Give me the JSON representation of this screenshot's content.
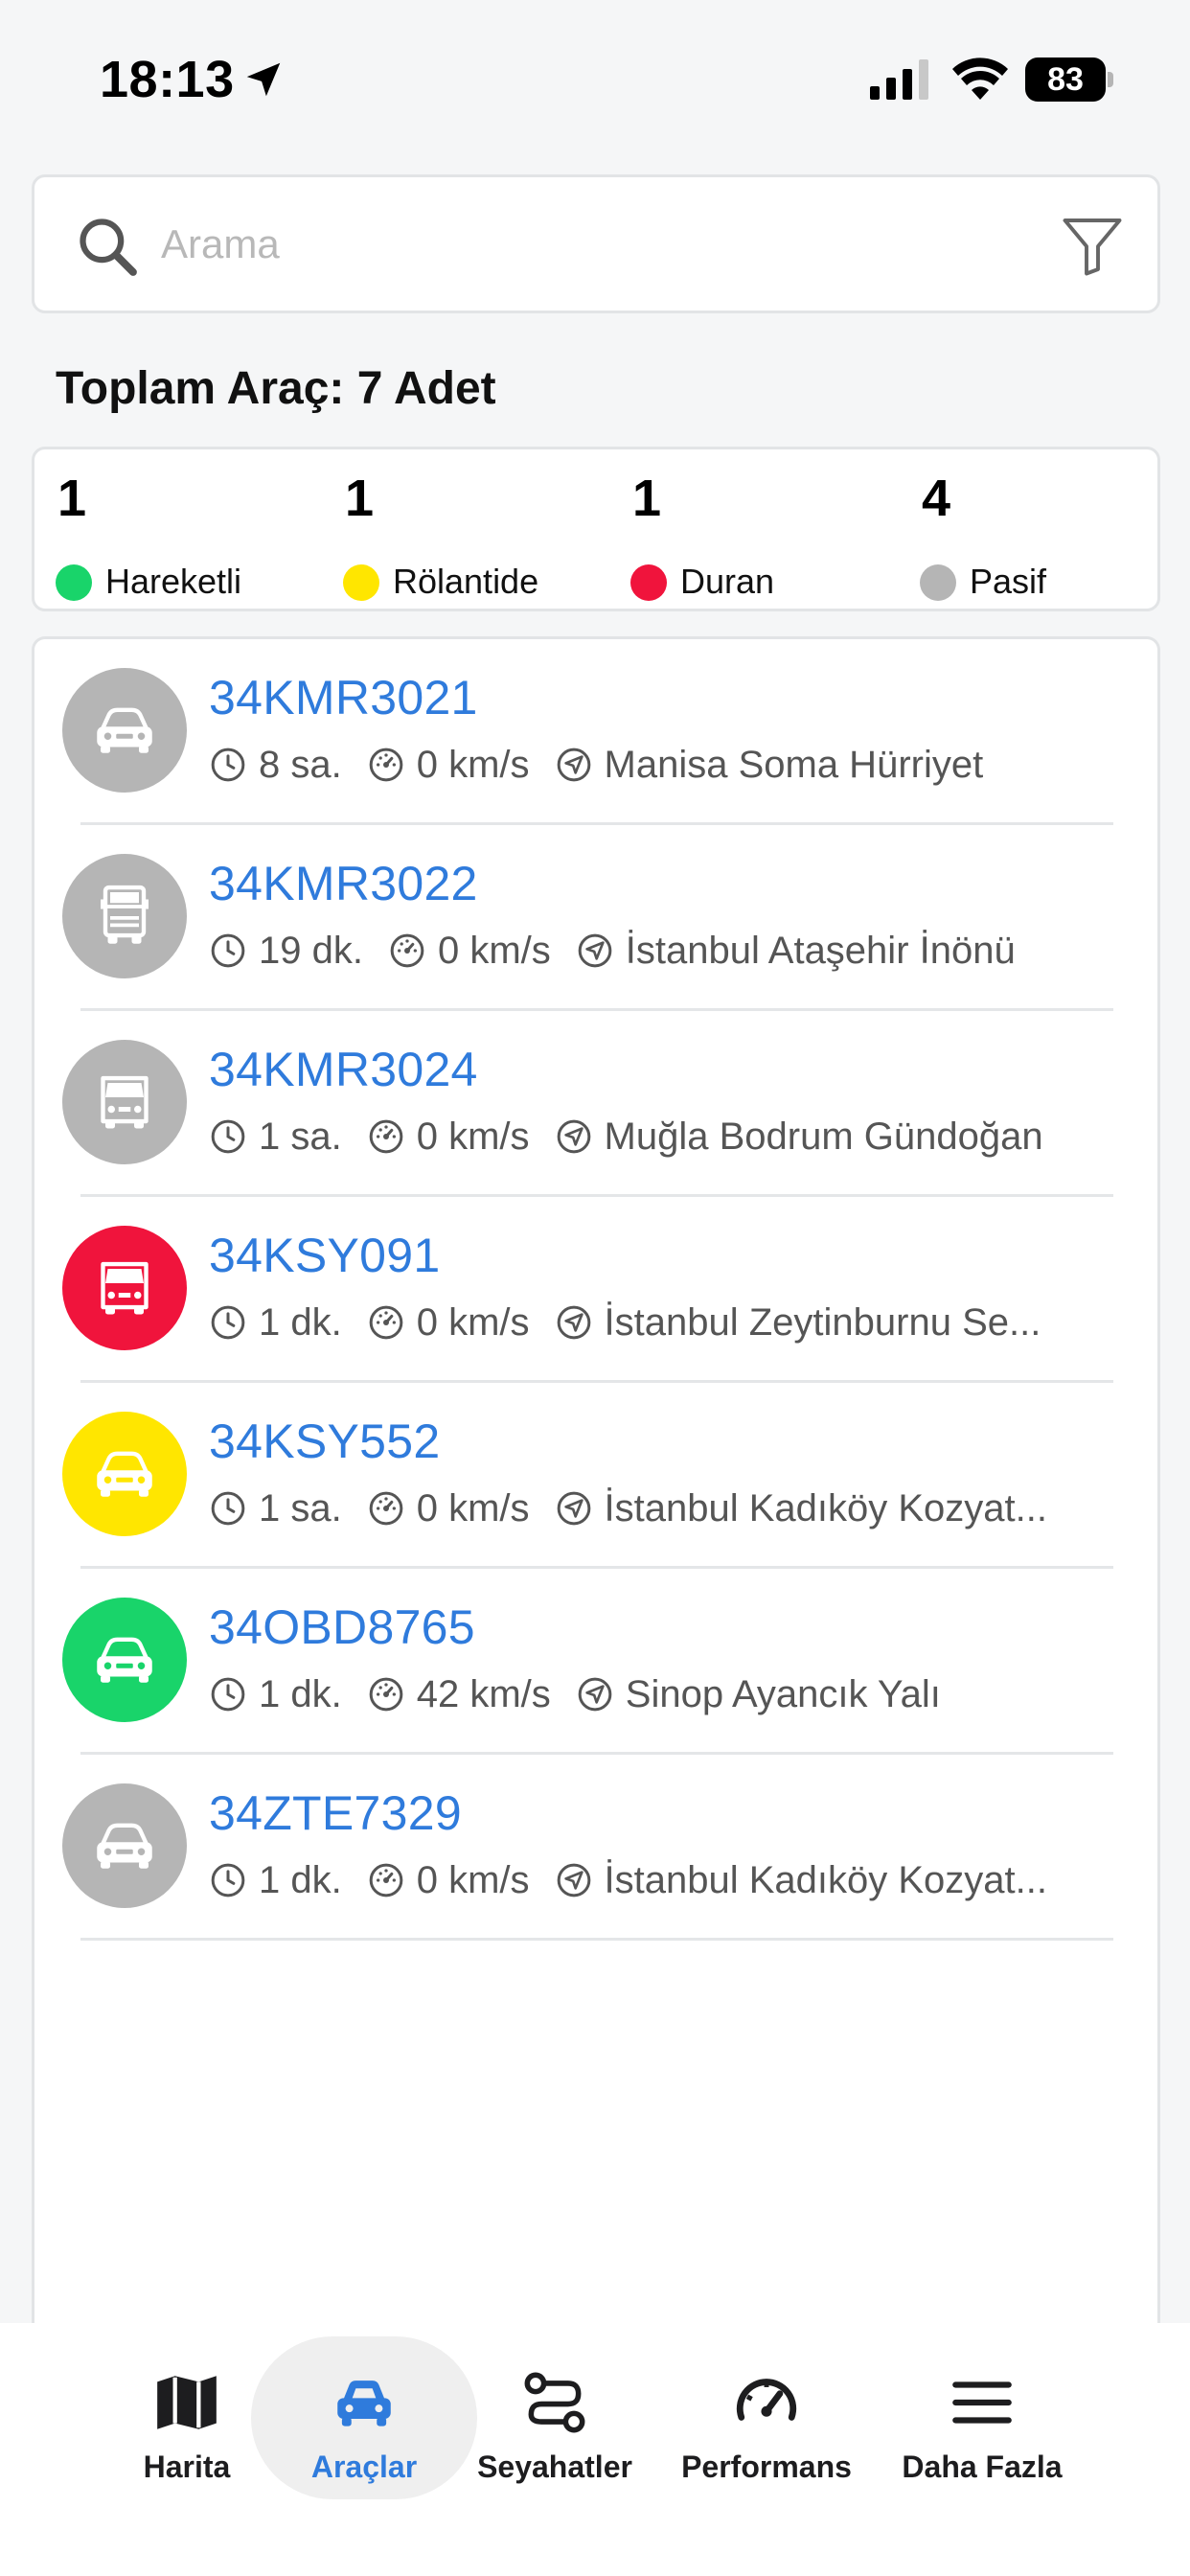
{
  "status_bar": {
    "time": "18:13",
    "battery": "83"
  },
  "search": {
    "placeholder": "Arama"
  },
  "summary": {
    "total_label": "Toplam Araç: 7 Adet"
  },
  "stats": [
    {
      "count": "1",
      "label": "Hareketli",
      "color": "#19d46a"
    },
    {
      "count": "1",
      "label": "Rölantide",
      "color": "#ffe600"
    },
    {
      "count": "1",
      "label": "Duran",
      "color": "#f0143c"
    },
    {
      "count": "4",
      "label": "Pasif",
      "color": "#b5b5b5"
    }
  ],
  "vehicles": [
    {
      "plate": "34KMR3021",
      "time": "8 sa.",
      "speed": "0 km/s",
      "location": "Manisa Soma Hürriyet",
      "status_color": "#b5b5b5",
      "icon": "car-icon"
    },
    {
      "plate": "34KMR3022",
      "time": "19 dk.",
      "speed": "0 km/s",
      "location": "İstanbul Ataşehir İnönü",
      "status_color": "#b5b5b5",
      "icon": "truck-icon"
    },
    {
      "plate": "34KMR3024",
      "time": "1 sa.",
      "speed": "0 km/s",
      "location": "Muğla Bodrum Gündoğan",
      "status_color": "#b5b5b5",
      "icon": "van-icon"
    },
    {
      "plate": "34KSY091",
      "time": "1 dk.",
      "speed": "0 km/s",
      "location": "İstanbul Zeytinburnu Se...",
      "status_color": "#f0143c",
      "icon": "van-icon"
    },
    {
      "plate": "34KSY552",
      "time": "1 sa.",
      "speed": "0 km/s",
      "location": "İstanbul Kadıköy Kozyat...",
      "status_color": "#ffe600",
      "icon": "car-icon"
    },
    {
      "plate": "34OBD8765",
      "time": "1 dk.",
      "speed": "42 km/s",
      "location": "Sinop Ayancık Yalı",
      "status_color": "#19d46a",
      "icon": "car-icon"
    },
    {
      "plate": "34ZTE7329",
      "time": "1 dk.",
      "speed": "0 km/s",
      "location": "İstanbul Kadıköy Kozyat...",
      "status_color": "#b5b5b5",
      "icon": "car-icon"
    }
  ],
  "tabs": [
    {
      "label": "Harita",
      "icon": "map-icon",
      "active": false
    },
    {
      "label": "Araçlar",
      "icon": "car-icon",
      "active": true
    },
    {
      "label": "Seyahatler",
      "icon": "route-icon",
      "active": false
    },
    {
      "label": "Performans",
      "icon": "speedometer-icon",
      "active": false
    },
    {
      "label": "Daha Fazla",
      "icon": "menu-icon",
      "active": false
    }
  ],
  "colors": {
    "accent": "#2f7bdc"
  }
}
